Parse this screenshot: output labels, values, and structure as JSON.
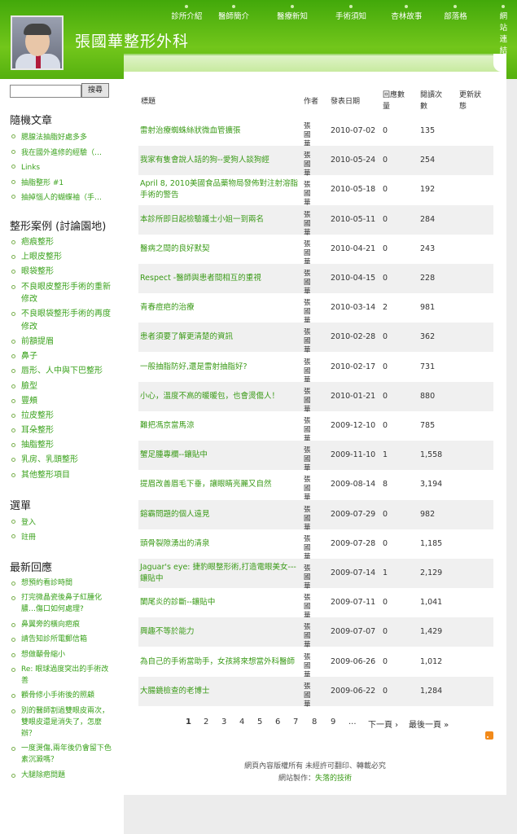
{
  "header": {
    "site_title": "張國華整形外科",
    "nav": [
      "診所介紹",
      "醫師簡介",
      "醫療新知",
      "手術須知",
      "杏林故事",
      "部落格",
      "網站連結"
    ]
  },
  "sidebar": {
    "search_button": "搜尋",
    "random_title": "隨機文章",
    "random": [
      "腮腺法抽脂好處多多",
      "我在國外進修的經驗（…",
      "Links",
      "抽脂整形 #1",
      "抽掉惱人的蝴蝶袖（手…"
    ],
    "cases_title": "整形案例 (討論園地)",
    "cases": [
      "疤痕整形",
      "上眼皮整形",
      "眼袋整形",
      "不良眼皮整形手術的重新修改",
      "不良眼袋整形手術的再度修改",
      "前額提眉",
      "鼻子",
      "唇形、人中與下巴整形",
      "臉型",
      "豐頰",
      "拉皮整形",
      "耳朵整形",
      "抽脂整形",
      "乳房、乳頭整形",
      "其他整形項目"
    ],
    "menu_title": "選單",
    "menu": [
      "登入",
      "註冊"
    ],
    "recent_title": "最新回應",
    "recent": [
      "想預約看診時間",
      "打完微晶瓷後鼻子紅腫化膿…傷口如何處理?",
      "鼻翼旁的橫向疤痕",
      "請告知診所電郵信箱",
      "想做顳骨縮小",
      "Re: 眼球過度突出的手術改善",
      "顴骨修小手術後的照顧",
      "別的醫師割過雙眼皮兩次，雙眼皮還是消失了，怎麼辦？",
      "一度燙傷,兩年後仍會留下色素沉澱嗎？",
      "大腿除疤問題"
    ]
  },
  "table": {
    "headers": {
      "title": "標題",
      "author": "作者",
      "date": "發表日期",
      "replies": "回應數量",
      "views": "閱讀次數",
      "updated": "更新狀態"
    },
    "rows": [
      {
        "title": "雷射治療蜘蛛絲狀微血管擴張",
        "author": "張國華",
        "date": "2010-07-02",
        "replies": "0",
        "views": "135"
      },
      {
        "title": "我家有隻會說人話的狗--愛狗人談狗經",
        "author": "張國華",
        "date": "2010-05-24",
        "replies": "0",
        "views": "254"
      },
      {
        "title": "April 8, 2010美國食品藥物局發佈對注射溶脂手術的警告",
        "author": "張國華",
        "date": "2010-05-18",
        "replies": "0",
        "views": "192"
      },
      {
        "title": "本診所即日起檢驗護士小姐一到兩名",
        "author": "張國華",
        "date": "2010-05-11",
        "replies": "0",
        "views": "284"
      },
      {
        "title": "醫病之間的良好默契",
        "author": "張國華",
        "date": "2010-04-21",
        "replies": "0",
        "views": "243"
      },
      {
        "title": "Respect -醫師與患者間相互的重視",
        "author": "張國華",
        "date": "2010-04-15",
        "replies": "0",
        "views": "228"
      },
      {
        "title": "青春痘疤的治療",
        "author": "張國華",
        "date": "2010-03-14",
        "replies": "2",
        "views": "981"
      },
      {
        "title": "患者須要了解更清楚的資訊",
        "author": "張國華",
        "date": "2010-02-28",
        "replies": "0",
        "views": "362"
      },
      {
        "title": "一般抽脂防好,還是雷射抽脂好?",
        "author": "張國華",
        "date": "2010-02-17",
        "replies": "0",
        "views": "731"
      },
      {
        "title": "小心，溫度不高的暖暖包，也會燙傷人！",
        "author": "張國華",
        "date": "2010-01-21",
        "replies": "0",
        "views": "880"
      },
      {
        "title": "難把馮京當馬涼",
        "author": "張國華",
        "date": "2009-12-10",
        "replies": "0",
        "views": "785"
      },
      {
        "title": "蟹足腫專欄--鑲貼中",
        "author": "張國華",
        "date": "2009-11-10",
        "replies": "1",
        "views": "1,558"
      },
      {
        "title": "提眉改善眉毛下垂，讓眼睛亮麗又自然",
        "author": "張國華",
        "date": "2009-08-14",
        "replies": "8",
        "views": "3,194"
      },
      {
        "title": "鎔霸問題的個人遠見",
        "author": "張國華",
        "date": "2009-07-29",
        "replies": "0",
        "views": "982"
      },
      {
        "title": "頭骨裂隙湧出的清泉",
        "author": "張國華",
        "date": "2009-07-28",
        "replies": "0",
        "views": "1,185"
      },
      {
        "title": "Jaguar's eye: 捷豹眼整形術,打造電眼美女---鑲貼中",
        "author": "張國華",
        "date": "2009-07-14",
        "replies": "1",
        "views": "2,129"
      },
      {
        "title": "闌尾炎的診斷--鑲貼中",
        "author": "張國華",
        "date": "2009-07-11",
        "replies": "0",
        "views": "1,041"
      },
      {
        "title": "興趣不等於能力",
        "author": "張國華",
        "date": "2009-07-07",
        "replies": "0",
        "views": "1,429"
      },
      {
        "title": "為自己的手術當助手，女孩將來想當外科醫師",
        "author": "張國華",
        "date": "2009-06-26",
        "replies": "0",
        "views": "1,012"
      },
      {
        "title": "大腸鏡檢查的老博士",
        "author": "張國華",
        "date": "2009-06-22",
        "replies": "0",
        "views": "1,284"
      }
    ]
  },
  "pager": {
    "pages": [
      "1",
      "2",
      "3",
      "4",
      "5",
      "6",
      "7",
      "8",
      "9",
      "..."
    ],
    "next": "下一頁 ›",
    "last": "最後一頁 »"
  },
  "footer": {
    "copyright": "網頁內容版權所有 未經許可翻印、轉載必究",
    "credit_label": "網站製作：",
    "credit_link": "失落的技術"
  },
  "colors": {
    "header_green": "#5ab915",
    "link_green": "#3a9a17"
  },
  "icons": {
    "rss": "rss-icon",
    "bullet": "bullet-icon"
  }
}
